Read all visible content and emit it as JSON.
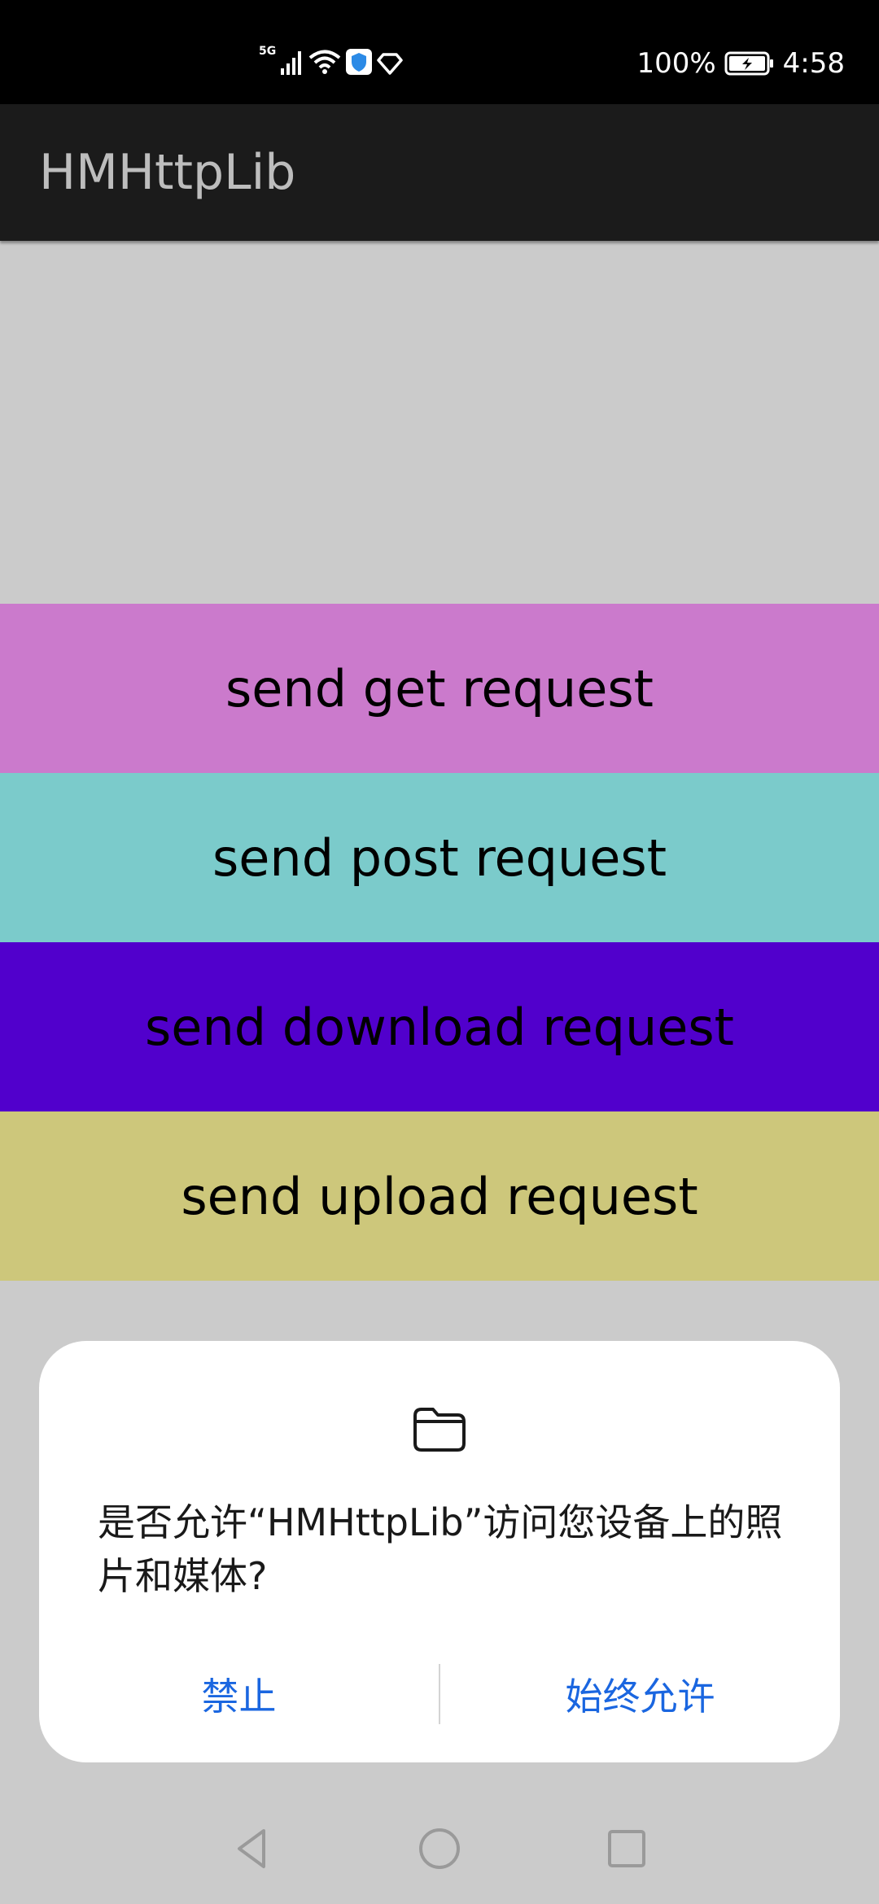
{
  "status_bar": {
    "network": "5G",
    "battery": "100%",
    "time": "4:58",
    "icons": [
      "signal-icon",
      "wifi-icon",
      "shield-icon",
      "diamond-icon",
      "battery-charging-icon"
    ]
  },
  "app_bar": {
    "title": "HMHttpLib"
  },
  "buttons": [
    {
      "label": "send get request",
      "color": "#cb7acc"
    },
    {
      "label": "send post request",
      "color": "#7bcbcb"
    },
    {
      "label": "send download request",
      "color": "#5100cc"
    },
    {
      "label": "send upload request",
      "color": "#cdc77b"
    }
  ],
  "dialog": {
    "icon": "folder-icon",
    "message": "是否允许“HMHttpLib”访问您设备上的照片和媒体?",
    "deny_label": "禁止",
    "allow_label": "始终允许",
    "accent_color": "#1a66e0"
  },
  "nav_bar": {
    "icons": [
      "back-icon",
      "home-icon",
      "recents-icon"
    ]
  }
}
